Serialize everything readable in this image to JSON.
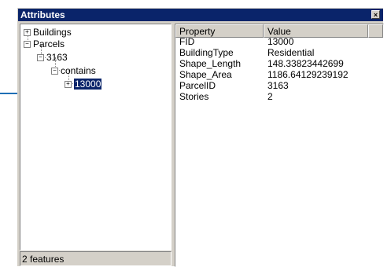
{
  "window": {
    "title": "Attributes",
    "close_glyph": "×"
  },
  "tree": {
    "buildings": "Buildings",
    "parcels": "Parcels",
    "parcel_id": "3163",
    "relation": "contains",
    "selected_feature": "13000",
    "expand_glyph": "+",
    "collapse_glyph": "−"
  },
  "status": {
    "text": "2 features"
  },
  "properties": {
    "header_property": "Property",
    "header_value": "Value",
    "rows": [
      {
        "name": "FID",
        "value": "13000"
      },
      {
        "name": "BuildingType",
        "value": "Residential"
      },
      {
        "name": "Shape_Length",
        "value": "148.33823442699"
      },
      {
        "name": "Shape_Area",
        "value": "1186.64129239192"
      },
      {
        "name": "ParcelID",
        "value": "3163"
      },
      {
        "name": "Stories",
        "value": "2"
      }
    ]
  },
  "colors": {
    "titlebar": "#0a246a",
    "callout": "#1f6fb5",
    "chrome": "#d4d0c8"
  }
}
